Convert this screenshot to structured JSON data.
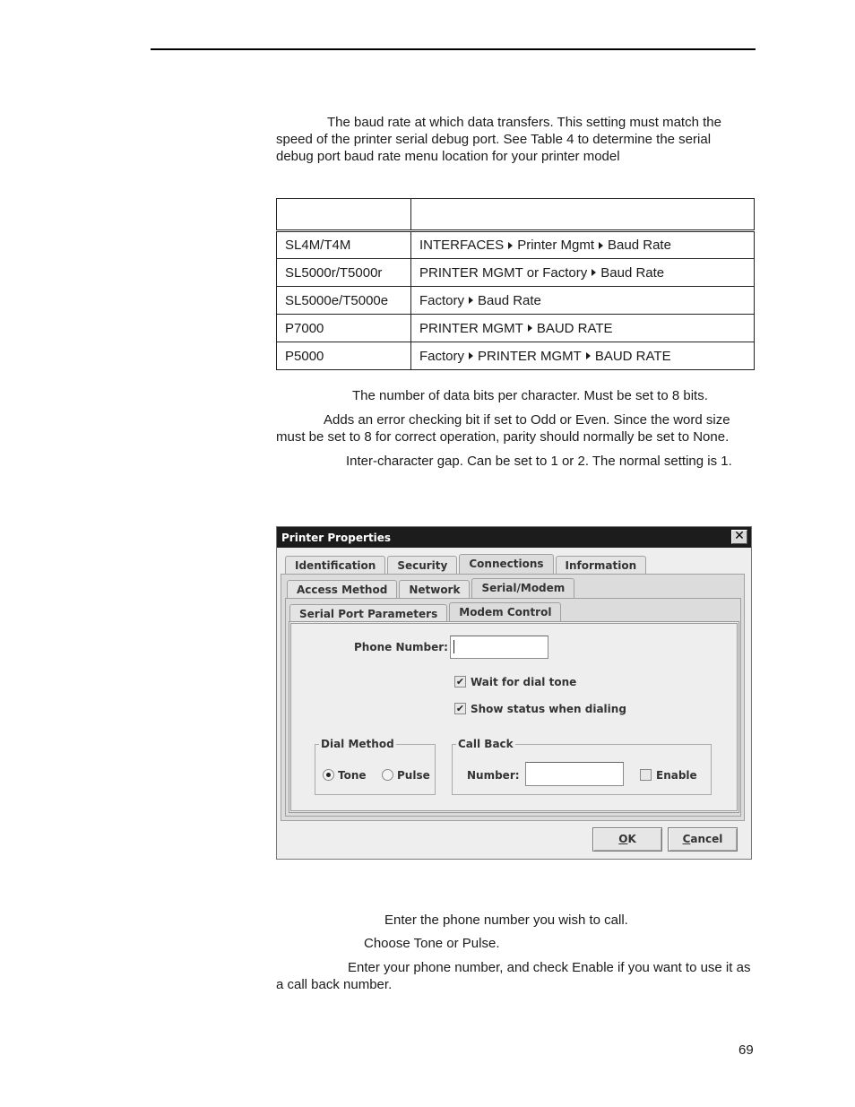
{
  "document": {
    "page_number": "69",
    "baud_rate_text": "The baud rate at which data transfers. This setting must match the speed of the printer serial debug port. See Table 4 to determine the serial debug port baud rate menu location for your printer model",
    "table": {
      "headers": [
        "",
        ""
      ],
      "rows": [
        {
          "model": "SL4M/T4M",
          "path": [
            "INTERFACES",
            "Printer Mgmt",
            "Baud Rate"
          ]
        },
        {
          "model": "SL5000r/T5000r",
          "path": [
            "PRINTER MGMT or Factory",
            "Baud Rate"
          ]
        },
        {
          "model": "SL5000e/T5000e",
          "path": [
            "Factory",
            "Baud Rate"
          ]
        },
        {
          "model": "P7000",
          "path": [
            "PRINTER MGMT",
            "BAUD RATE"
          ]
        },
        {
          "model": "P5000",
          "path": [
            "Factory",
            "PRINTER MGMT",
            "BAUD RATE"
          ]
        }
      ]
    },
    "word_size_text": "The number of data bits per character. Must be set to 8 bits.",
    "parity_text": "Adds an error checking bit if set to Odd or Even. Since the word size must be set to 8 for correct operation, parity should normally be set to None.",
    "stop_bits_text": "Inter-character gap. Can be set to 1 or 2. The normal setting is 1.",
    "phone_number_text": "Enter the phone number you wish to call.",
    "dial_method_text": "Choose Tone or Pulse.",
    "call_back_text": "Enter your phone number, and check Enable if you want to use it as a call back number."
  },
  "dialog": {
    "title": "Printer Properties",
    "close_glyph": "✕",
    "tabs_level1": [
      "Identification",
      "Security",
      "Connections",
      "Information"
    ],
    "tabs_level1_active": "Connections",
    "tabs_level2": [
      "Access Method",
      "Network",
      "Serial/Modem"
    ],
    "tabs_level2_active": "Serial/Modem",
    "tabs_level3": [
      "Serial Port Parameters",
      "Modem Control"
    ],
    "tabs_level3_active": "Modem Control",
    "phone_number_label": "Phone Number:",
    "phone_number_value": "",
    "wait_dial_tone": {
      "label": "Wait for dial tone",
      "checked": true
    },
    "show_status": {
      "label": "Show status when dialing",
      "checked": true
    },
    "dial_method": {
      "title": "Dial Method",
      "options": [
        "Tone",
        "Pulse"
      ],
      "selected": "Tone"
    },
    "call_back": {
      "title": "Call Back",
      "number_label": "Number:",
      "number_value": "",
      "enable": {
        "label": "Enable",
        "checked": false
      }
    },
    "ok_label": "OK",
    "ok_mnemonic": "O",
    "ok_rest": "K",
    "cancel_label": "Cancel",
    "cancel_mnemonic": "C",
    "cancel_rest": "ancel",
    "check_glyph": "✔"
  }
}
